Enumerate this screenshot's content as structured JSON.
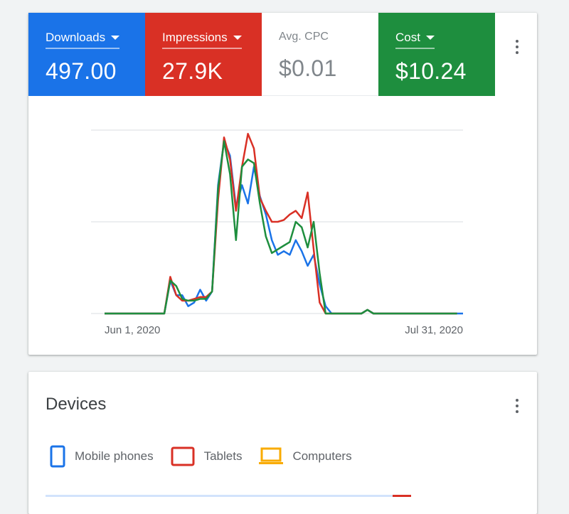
{
  "performance": {
    "metrics": [
      {
        "label": "Downloads",
        "value": "497.00",
        "color": "#1a73e8",
        "selectable": true
      },
      {
        "label": "Impressions",
        "value": "27.9K",
        "color": "#d93025",
        "selectable": true
      },
      {
        "label": "Avg. CPC",
        "value": "$0.01",
        "color": "#ffffff",
        "selectable": false
      },
      {
        "label": "Cost",
        "value": "$10.24",
        "color": "#1e8e3e",
        "selectable": true
      }
    ],
    "menu_icon": "more-vert-icon"
  },
  "chart_data": {
    "type": "line",
    "x_start_label": "Jun 1, 2020",
    "x_end_label": "Jul 31, 2020",
    "x_count": 61,
    "grid": true,
    "series": [
      {
        "color": "#1a73e8",
        "values": [
          0,
          0,
          0,
          0,
          0,
          0,
          0,
          0,
          0,
          0,
          0,
          18,
          10,
          10,
          4,
          6,
          13,
          7,
          12,
          70,
          94,
          86,
          58,
          70,
          60,
          80,
          64,
          54,
          40,
          32,
          34,
          32,
          40,
          34,
          26,
          32,
          16,
          4,
          0,
          0,
          0,
          0,
          0,
          0,
          2,
          0,
          0,
          0,
          0,
          0,
          0,
          0,
          0,
          0,
          0,
          0,
          0,
          0,
          0,
          0,
          0
        ]
      },
      {
        "color": "#d93025",
        "values": [
          0,
          0,
          0,
          0,
          0,
          0,
          0,
          0,
          0,
          0,
          0,
          20,
          10,
          7,
          7,
          8,
          9,
          9,
          12,
          62,
          96,
          84,
          56,
          80,
          98,
          90,
          63,
          56,
          50,
          50,
          51,
          54,
          56,
          52,
          66,
          35,
          6,
          0,
          0,
          0,
          0,
          0,
          0,
          0,
          2,
          0,
          0,
          0,
          0,
          0,
          0,
          0,
          0,
          0,
          0,
          0,
          0,
          0,
          0,
          0
        ]
      },
      {
        "color": "#1e8e3e",
        "values": [
          0,
          0,
          0,
          0,
          0,
          0,
          0,
          0,
          0,
          0,
          0,
          18,
          15,
          8,
          7,
          7,
          8,
          8,
          12,
          68,
          94,
          76,
          40,
          80,
          84,
          82,
          60,
          42,
          33,
          35,
          37,
          39,
          50,
          47,
          36,
          50,
          22,
          0,
          0,
          0,
          0,
          0,
          0,
          0,
          2,
          0,
          0,
          0,
          0,
          0,
          0,
          0,
          0,
          0,
          0,
          0,
          0,
          0,
          0,
          0
        ]
      }
    ],
    "ylim": [
      0,
      100
    ]
  },
  "devices": {
    "title": "Devices",
    "menu_icon": "more-vert-icon",
    "legend": [
      {
        "label": "Mobile phones",
        "icon": "smartphone-icon",
        "color": "#1a73e8"
      },
      {
        "label": "Tablets",
        "icon": "tablet-icon",
        "color": "#d93025"
      },
      {
        "label": "Computers",
        "icon": "laptop-icon",
        "color": "#f9ab00"
      }
    ]
  }
}
